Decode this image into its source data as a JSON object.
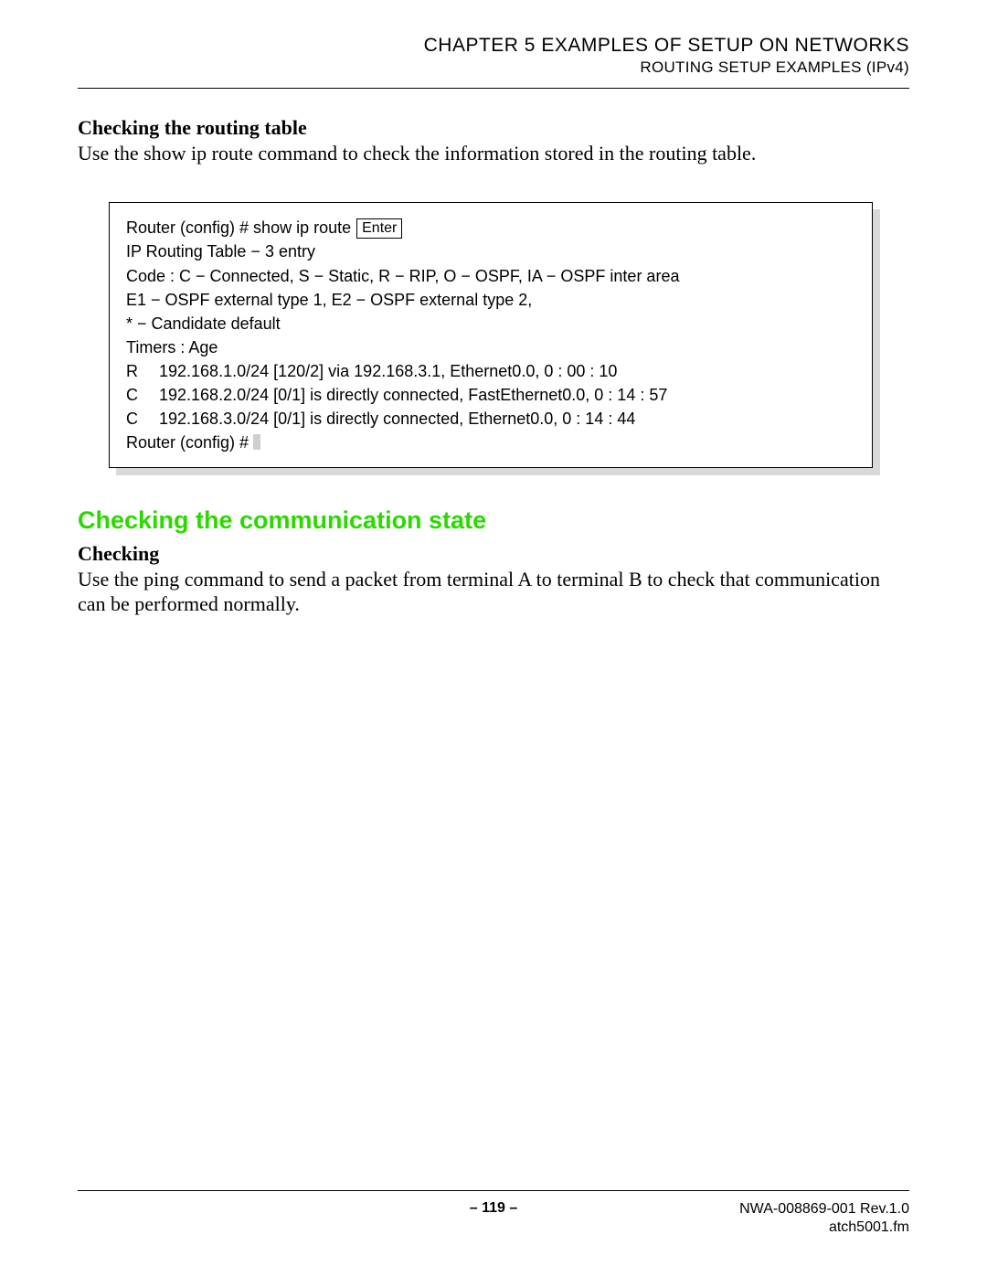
{
  "header": {
    "chapter": "CHAPTER 5   EXAMPLES OF SETUP ON NETWORKS",
    "section": "ROUTING SETUP EXAMPLES (IPv4)"
  },
  "sec1": {
    "title": "Checking the routing table",
    "text": "Use the show ip route command to check the information stored in the routing table."
  },
  "code": {
    "prompt_cmd": "Router (config) # show ip route ",
    "enter_label": "Enter",
    "l2": "IP Routing Table − 3 entry",
    "l3": "Code : C − Connected, S − Static, R − RIP, O − OSPF, IA − OSPF inter area",
    "l4": "E1 − OSPF external type 1, E2 − OSPF external type 2,",
    "l5": "* − Candidate default",
    "l6": "Timers : Age",
    "routes": [
      {
        "code": "R",
        "text": "192.168.1.0/24 [120/2] via 192.168.3.1, Ethernet0.0, 0 : 00 : 10"
      },
      {
        "code": "C",
        "text": "192.168.2.0/24 [0/1] is directly connected, FastEthernet0.0, 0 : 14 : 57"
      },
      {
        "code": "C",
        "text": "192.168.3.0/24 [0/1] is directly connected, Ethernet0.0, 0 : 14 : 44"
      }
    ],
    "end_prompt": "Router (config) # "
  },
  "sec2": {
    "heading": "Checking the communication state",
    "subhead": "Checking",
    "text": "Use the ping command to send a packet from terminal A to terminal B to check that communication can be performed normally."
  },
  "footer": {
    "page": "– 119 –",
    "docid": "NWA-008869-001 Rev.1.0",
    "file": "atch5001.fm"
  }
}
